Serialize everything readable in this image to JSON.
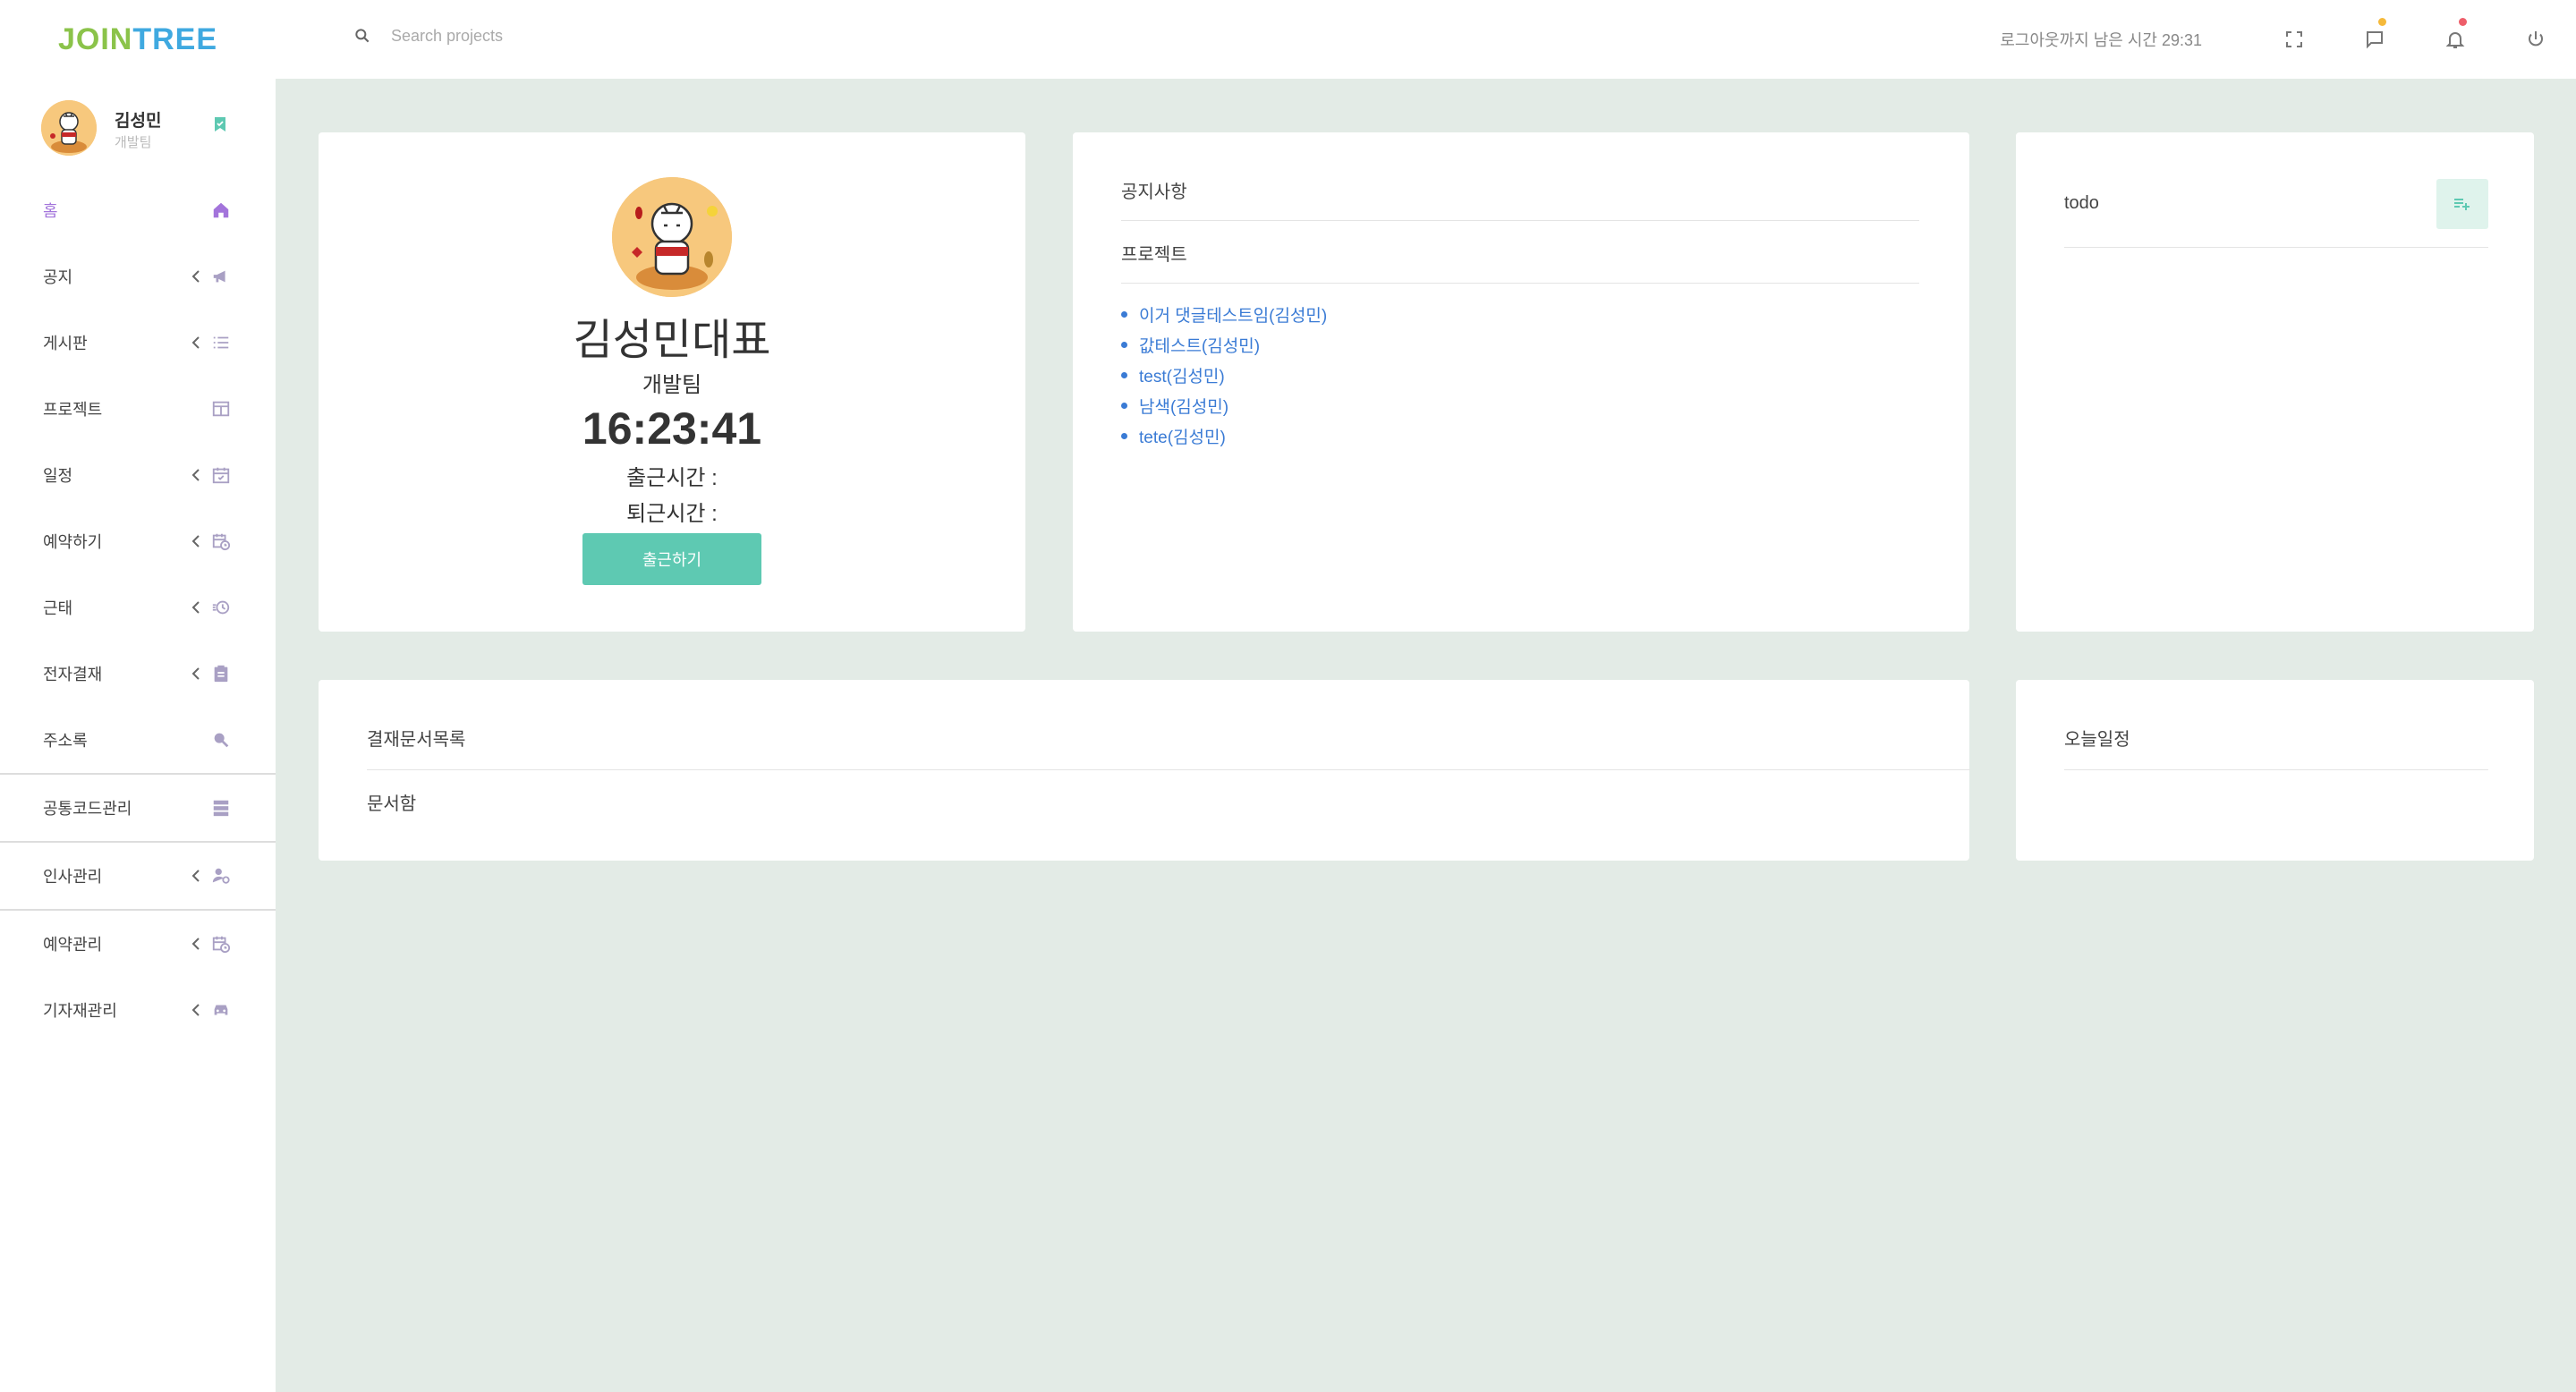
{
  "brand": {
    "part1": "JOIN",
    "part2": "TREE"
  },
  "search": {
    "placeholder": "Search projects"
  },
  "header": {
    "logout_timer": "로그아웃까지 남은 시간 29:31"
  },
  "colors": {
    "accent_green": "#5ec9b2",
    "menu_active": "#a374db",
    "link_blue": "#3a7bd5",
    "brand_green": "#8bc34a",
    "brand_blue": "#3fa9e0"
  },
  "sidebar": {
    "user": {
      "name": "김성민",
      "team": "개발팀"
    },
    "items": [
      {
        "label": "홈",
        "icon": "home-icon"
      },
      {
        "label": "공지",
        "icon": "megaphone-icon"
      },
      {
        "label": "게시판",
        "icon": "list-icon"
      },
      {
        "label": "프로젝트",
        "icon": "board-icon"
      },
      {
        "label": "일정",
        "icon": "calendar-check-icon"
      },
      {
        "label": "예약하기",
        "icon": "calendar-clock-icon"
      },
      {
        "label": "근태",
        "icon": "clock-icon"
      },
      {
        "label": "전자결재",
        "icon": "clipboard-icon"
      },
      {
        "label": "주소록",
        "icon": "person-search-icon"
      },
      {
        "label": "공통코드관리",
        "icon": "storage-icon"
      },
      {
        "label": "인사관리",
        "icon": "user-settings-icon"
      },
      {
        "label": "예약관리",
        "icon": "calendar-clock-icon"
      },
      {
        "label": "기자재관리",
        "icon": "car-icon"
      }
    ]
  },
  "profile_card": {
    "name": "김성민대표",
    "team": "개발팀",
    "clock": "16:23:41",
    "check_in_label": "출근시간 :",
    "check_out_label": "퇴근시간 :",
    "check_in_button": "출근하기"
  },
  "notice_card": {
    "notice_title": "공지사항",
    "project_title": "프로젝트",
    "projects": [
      "이거 댓글테스트임(김성민)",
      "값테스트(김성민)",
      "test(김성민)",
      "남색(김성민)",
      "tete(김성민)"
    ]
  },
  "todo_card": {
    "title": "todo"
  },
  "docs_card": {
    "title": "결재문서목록",
    "subtitle": "문서함"
  },
  "today_card": {
    "title": "오늘일정"
  }
}
